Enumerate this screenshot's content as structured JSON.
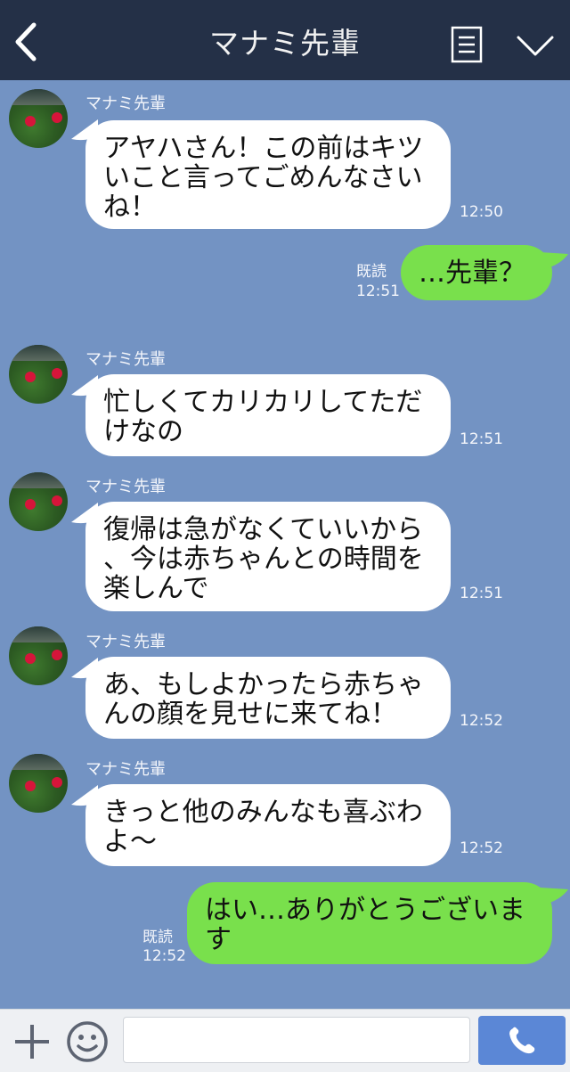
{
  "header": {
    "title": "マナミ先輩",
    "back_icon": "back-arrow-icon",
    "menu_icon": "menu-list-icon",
    "collapse_icon": "chevron-down-icon",
    "background": "#243047"
  },
  "chat": {
    "background": "#7393c3",
    "messages": [
      {
        "sender": "マナミ先輩",
        "side": "left",
        "text": "アヤハさん！この前はキツ\nいこと言ってごめんなさい\nね！",
        "time": "12:50"
      },
      {
        "sender": "me",
        "side": "right",
        "text": "…先輩？",
        "read": "既読",
        "time": "12:51"
      },
      {
        "sender": "マナミ先輩",
        "side": "left",
        "text": "忙しくてカリカリしてただ\nけなの",
        "time": "12:51"
      },
      {
        "sender": "マナミ先輩",
        "side": "left",
        "text": "復帰は急がなくていいから\n、今は赤ちゃんとの時間を\n楽しんで",
        "time": "12:51"
      },
      {
        "sender": "マナミ先輩",
        "side": "left",
        "text": "あ、もしよかったら赤ちゃ\nんの顔を見せに来てね！",
        "time": "12:52"
      },
      {
        "sender": "マナミ先輩",
        "side": "left",
        "text": "きっと他のみんなも喜ぶわ\nよ〜",
        "time": "12:52"
      },
      {
        "sender": "me",
        "side": "right",
        "text": "はい…ありがとうございま\nす",
        "read": "既読",
        "time": "12:52"
      }
    ]
  },
  "bottom_bar": {
    "plus_icon": "plus-icon",
    "emoji_icon": "smiley-icon",
    "input_value": "",
    "call_icon": "phone-icon",
    "call_color": "#5b87d6"
  }
}
